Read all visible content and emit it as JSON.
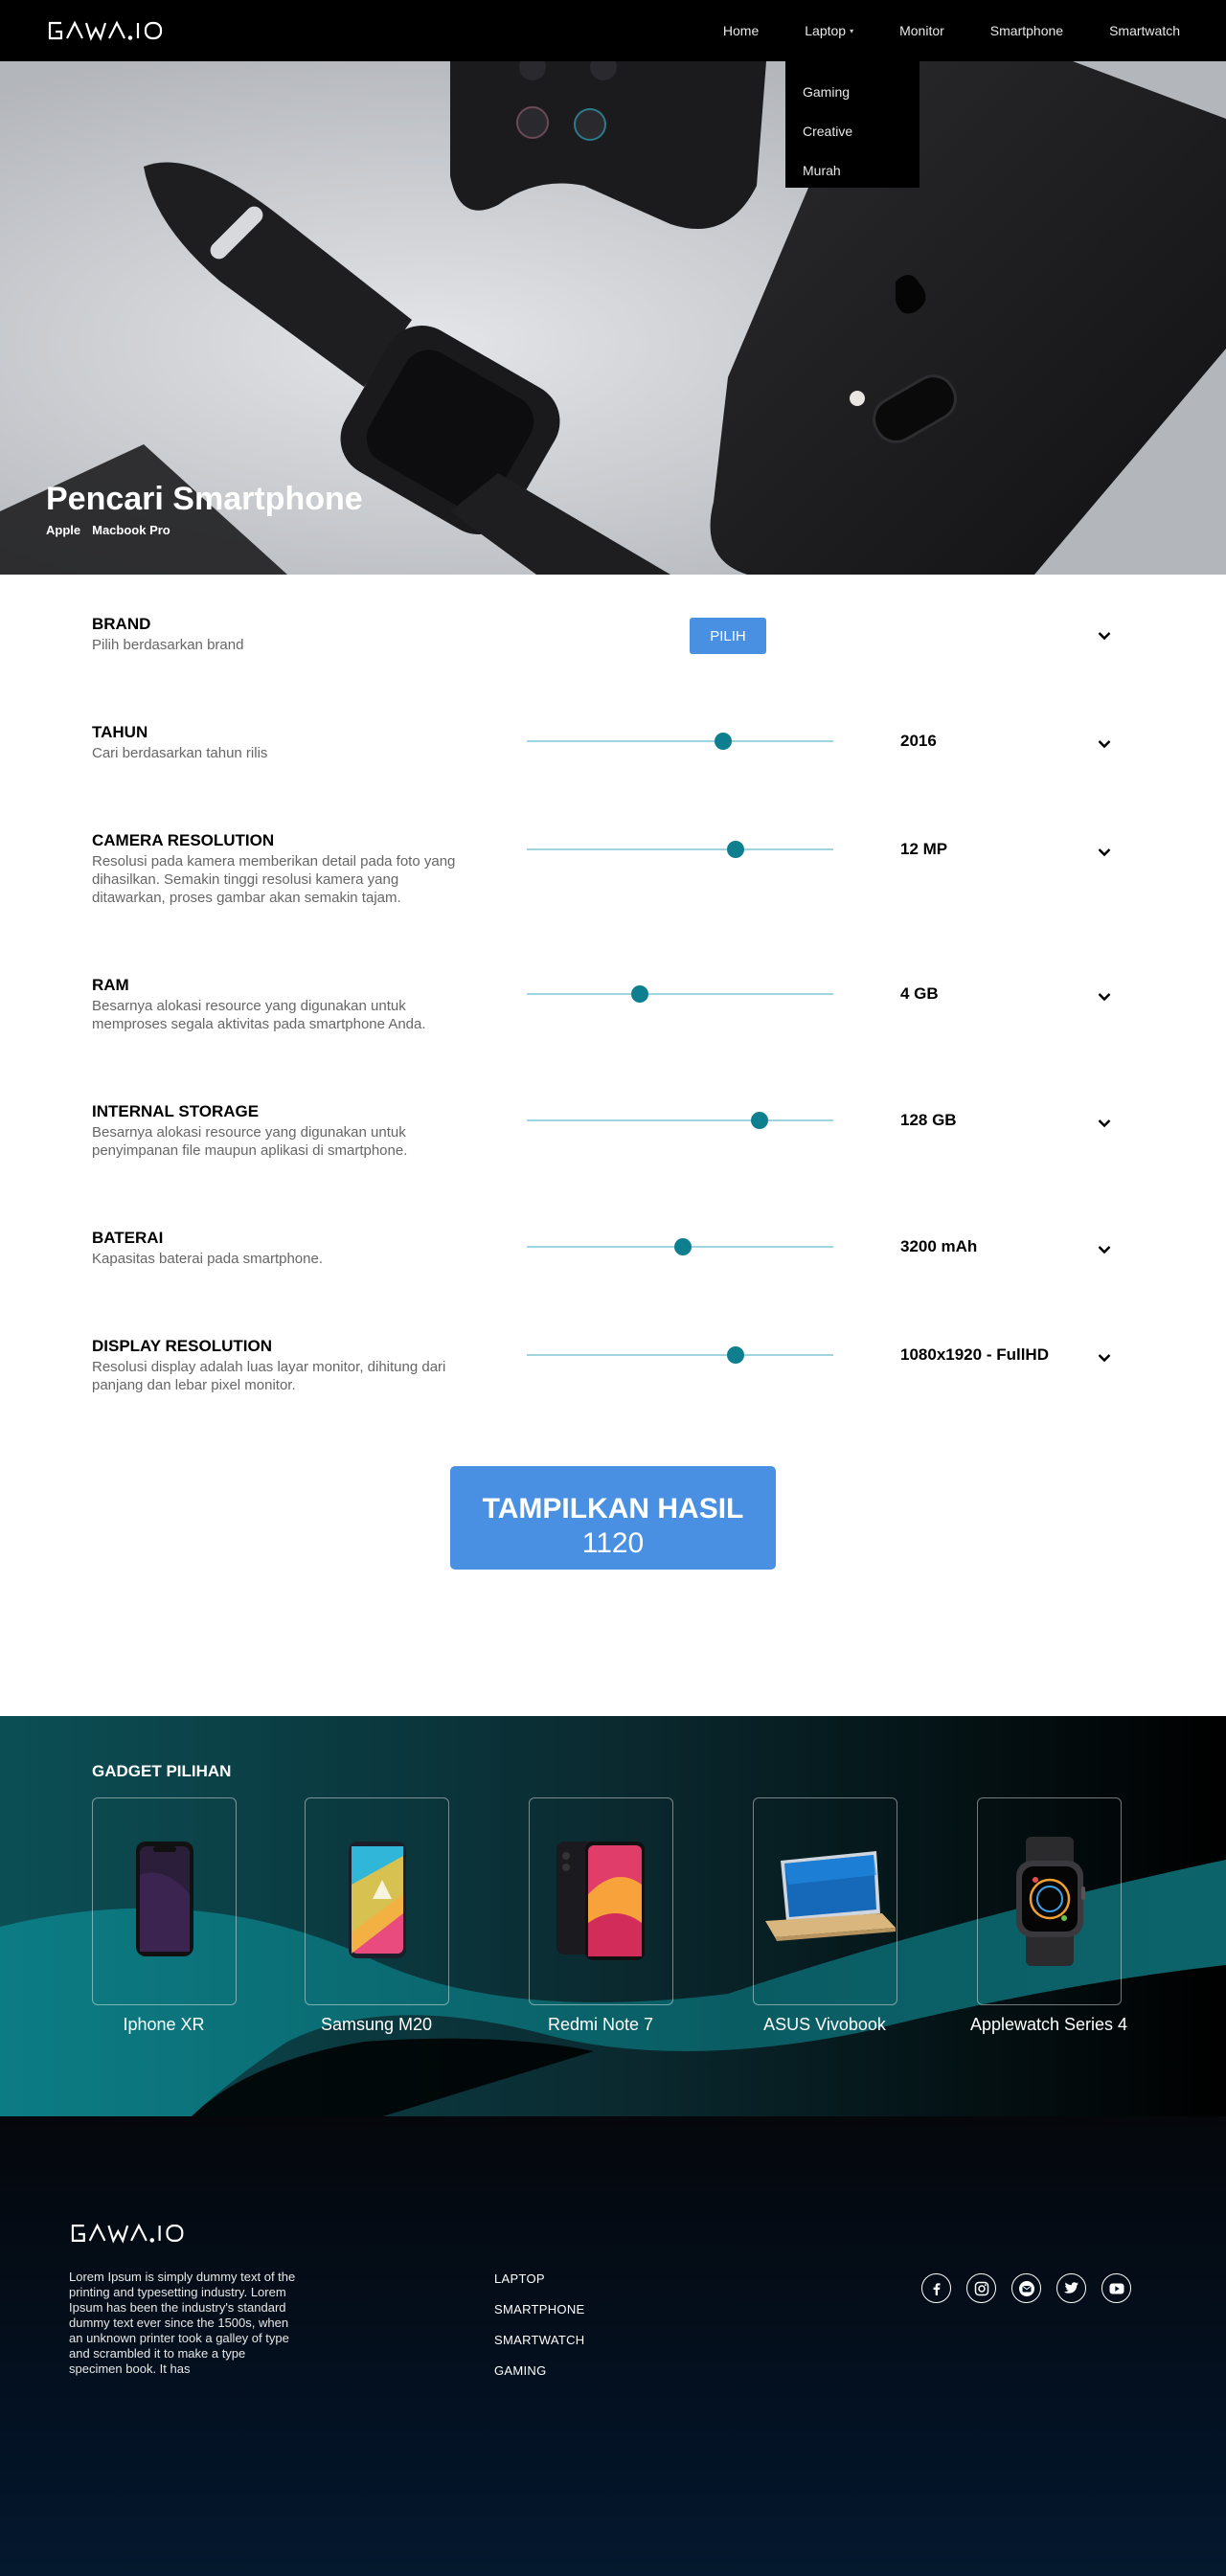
{
  "brand": {
    "logo_text": "GAWAI.IO"
  },
  "nav": {
    "items": [
      "Home",
      "Laptop",
      "Monitor",
      "Smartphone",
      "Smartwatch"
    ],
    "dropdown": [
      "Gaming",
      "Creative",
      "Murah"
    ]
  },
  "hero": {
    "title": "Pencari Smartphone",
    "breadcrumb": [
      "Apple",
      "Macbook Pro"
    ]
  },
  "filters": [
    {
      "label": "BRAND",
      "desc": "Pilih berdasarkan brand",
      "button": "PILIH"
    },
    {
      "label": "TAHUN",
      "desc": "Cari berdasarkan tahun rilis",
      "value": "2016",
      "level": 0.64
    },
    {
      "label": "CAMERA RESOLUTION",
      "desc": "Resolusi pada kamera memberikan detail pada foto yang dihasilkan. Semakin tinggi resolusi kamera yang ditawarkan, proses gambar akan semakin tajam.",
      "value": "12 MP",
      "level": 0.68
    },
    {
      "label": "RAM",
      "desc": "Besarnya alokasi resource yang digunakan untuk memproses segala aktivitas pada smartphone Anda.",
      "value": "4 GB",
      "level": 0.37
    },
    {
      "label": "INTERNAL STORAGE",
      "desc": "Besarnya alokasi resource yang digunakan untuk penyimpanan file maupun aplikasi di smartphone.",
      "value": "128 GB",
      "level": 0.76
    },
    {
      "label": "BATERAI",
      "desc": "Kapasitas baterai pada smartphone.",
      "value": "3200 mAh",
      "level": 0.51
    },
    {
      "label": "DISPLAY RESOLUTION",
      "desc": "Resolusi display adalah luas layar monitor, dihitung dari panjang dan lebar pixel monitor.",
      "value": "1080x1920 - FullHD",
      "level": 0.68
    }
  ],
  "cta": {
    "label": "TAMPILKAN HASIL",
    "count": "1120"
  },
  "gadgets": {
    "title": "GADGET PILIHAN",
    "items": [
      "Iphone XR",
      "Samsung M20",
      "Redmi Note 7",
      "ASUS Vivobook",
      "Applewatch Series 4"
    ]
  },
  "footer": {
    "about": "Lorem Ipsum is simply dummy text of the printing and typesetting industry. Lorem Ipsum has been the industry's standard dummy text ever since the 1500s, when an unknown printer took a galley of type and scrambled it to make a type specimen book. It has",
    "links": [
      "LAPTOP",
      "SMARTPHONE",
      "SMARTWATCH",
      "GAMING"
    ],
    "socials": [
      "facebook-icon",
      "instagram-icon",
      "mail-icon",
      "twitter-icon",
      "youtube-icon"
    ]
  },
  "colors": {
    "accent": "#4a90e2",
    "slider": "#0e7f8f",
    "nav_bg": "#000000",
    "footer_bg": "#031224",
    "teal": "#0b6a72"
  }
}
